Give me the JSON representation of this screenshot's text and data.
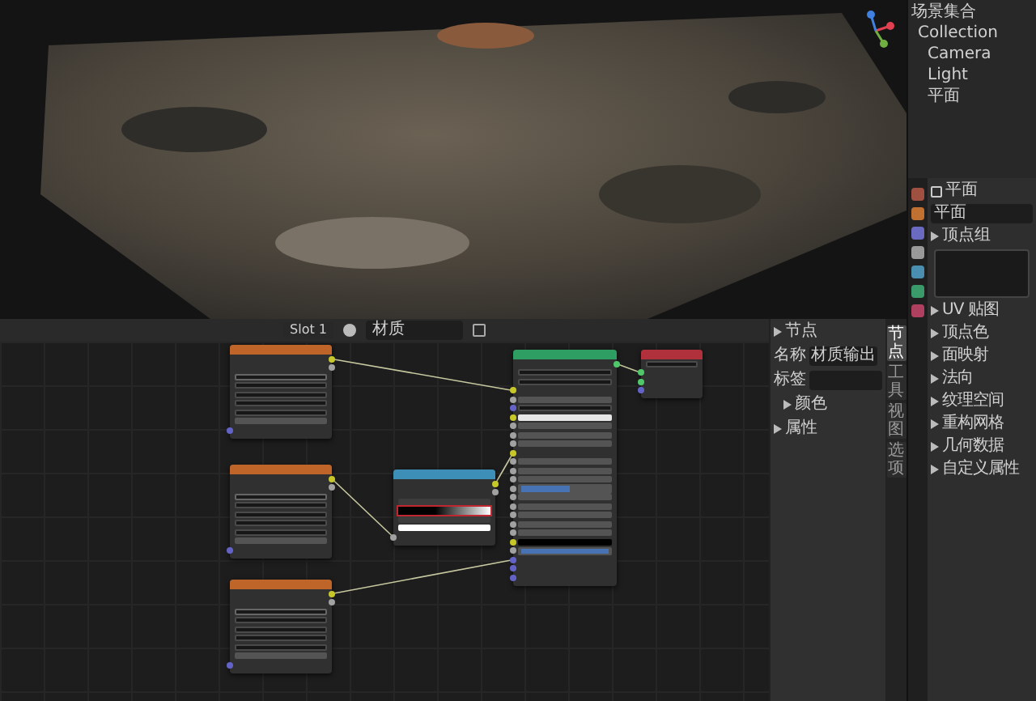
{
  "node_editor": {
    "header": {
      "slot": "Slot 1",
      "material": "材质"
    },
    "nodes": [
      {
        "kind": "image",
        "color": "#c0652a",
        "rows": [
          {
            "kind": "output"
          },
          {
            "kind": "output"
          },
          {
            "kind": "select"
          },
          {
            "kind": "dropdown"
          },
          {
            "kind": "dropdown"
          },
          {
            "kind": "dropdown"
          },
          {
            "kind": "dropdown"
          },
          {
            "kind": "field"
          },
          {
            "kind": "input"
          }
        ]
      },
      {
        "kind": "image",
        "color": "#c0652a",
        "rows": [
          {
            "kind": "output"
          },
          {
            "kind": "output"
          },
          {
            "kind": "select"
          },
          {
            "kind": "dropdown"
          },
          {
            "kind": "dropdown"
          },
          {
            "kind": "dropdown"
          },
          {
            "kind": "dropdown"
          },
          {
            "kind": "field"
          },
          {
            "kind": "input"
          }
        ]
      },
      {
        "kind": "image",
        "color": "#c0652a",
        "rows": [
          {
            "kind": "output"
          },
          {
            "kind": "output"
          },
          {
            "kind": "select"
          },
          {
            "kind": "dropdown"
          },
          {
            "kind": "dropdown"
          },
          {
            "kind": "dropdown"
          },
          {
            "kind": "dropdown"
          },
          {
            "kind": "field"
          },
          {
            "kind": "input"
          }
        ]
      },
      {
        "kind": "ramp",
        "color": "#3d8fb8",
        "rows": [
          {
            "kind": "output"
          },
          {
            "kind": "output"
          },
          {
            "kind": "controls"
          },
          {
            "kind": "gradient",
            "highlighted": true
          },
          {
            "kind": "controls"
          },
          {
            "kind": "swatch",
            "color": "#ffffff"
          },
          {
            "kind": "input"
          }
        ]
      },
      {
        "kind": "bsdf",
        "color": "#2f9e62",
        "rows": [
          {
            "kind": "output"
          },
          {
            "kind": "dropdown"
          },
          {
            "kind": "dropdown"
          },
          {
            "kind": "input"
          },
          {
            "kind": "field"
          },
          {
            "kind": "dropdown"
          },
          {
            "kind": "swatch",
            "color": "#e6e6e6"
          },
          {
            "kind": "field"
          },
          {
            "kind": "field"
          },
          {
            "kind": "field"
          },
          {
            "kind": "input"
          },
          {
            "kind": "field"
          },
          {
            "kind": "field"
          },
          {
            "kind": "field"
          },
          {
            "kind": "slider",
            "level": 0.55
          },
          {
            "kind": "field"
          },
          {
            "kind": "field"
          },
          {
            "kind": "field"
          },
          {
            "kind": "field"
          },
          {
            "kind": "field"
          },
          {
            "kind": "swatch",
            "color": "#000000"
          },
          {
            "kind": "slider",
            "level": 1
          },
          {
            "kind": "input"
          },
          {
            "kind": "input"
          },
          {
            "kind": "input"
          }
        ]
      },
      {
        "kind": "output",
        "color": "#b0303c",
        "rows": [
          {
            "kind": "dropdown"
          },
          {
            "kind": "input"
          },
          {
            "kind": "input"
          },
          {
            "kind": "input"
          }
        ]
      }
    ]
  },
  "sidebar": {
    "section": "节点",
    "name_label": "名称",
    "name_value": "材质输出",
    "label_label": "标签",
    "color_section": "颜色",
    "properties_section": "属性",
    "tabs": [
      {
        "label": "节点",
        "selected": true
      },
      {
        "label": "工具",
        "selected": false
      },
      {
        "label": "视图",
        "selected": false
      },
      {
        "label": "选项",
        "selected": false
      }
    ]
  },
  "outliner": {
    "title": "场景集合",
    "items": [
      "Collection",
      "Camera",
      "Light",
      "平面"
    ]
  },
  "properties": {
    "object": "平面",
    "data": "平面",
    "first_panel": "顶点组",
    "panels": [
      "UV 贴图",
      "顶点色",
      "面映射",
      "法向",
      "纹理空间",
      "重构网格",
      "几何数据",
      "自定义属性"
    ]
  }
}
